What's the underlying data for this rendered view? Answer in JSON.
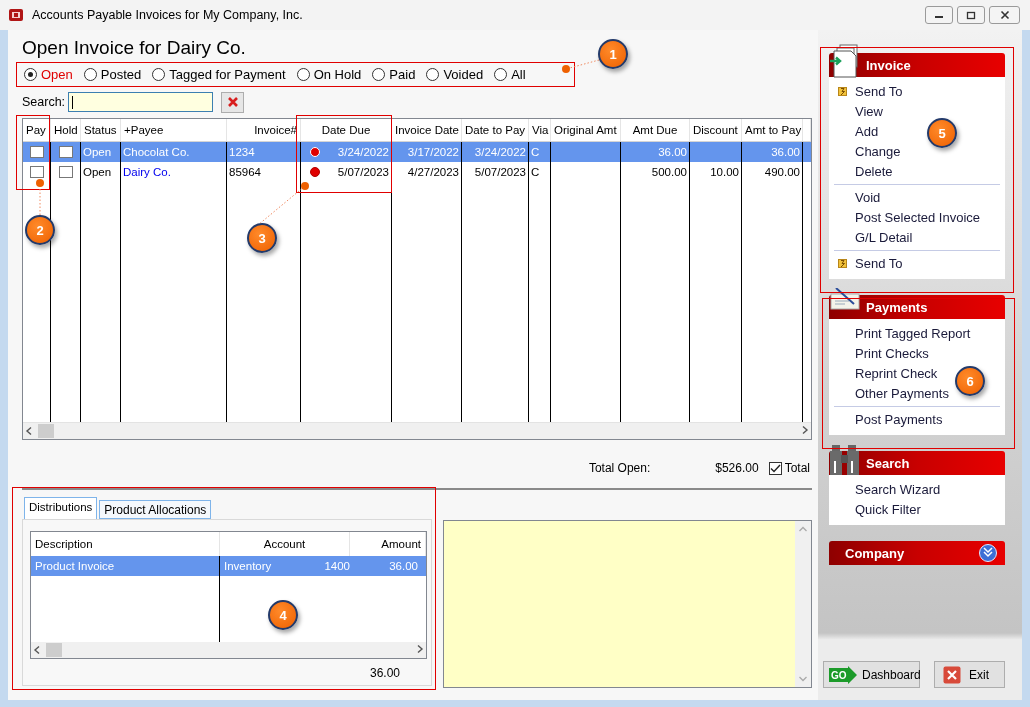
{
  "window": {
    "title": "Accounts Payable Invoices for My Company, Inc."
  },
  "heading": "Open Invoice for Dairy Co.",
  "filters": [
    {
      "label": "Open",
      "selected": true
    },
    {
      "label": "Posted",
      "selected": false
    },
    {
      "label": "Tagged for Payment",
      "selected": false
    },
    {
      "label": "On Hold",
      "selected": false
    },
    {
      "label": "Paid",
      "selected": false
    },
    {
      "label": "Voided",
      "selected": false
    },
    {
      "label": "All",
      "selected": false
    }
  ],
  "search": {
    "label": "Search:"
  },
  "invoices": {
    "columns": [
      "Pay",
      "Hold",
      "Status",
      "+Payee",
      "Invoice#",
      "Date Due",
      "Invoice Date",
      "Date to Pay",
      "Via",
      "Original Amt",
      "Amt Due",
      "Discount",
      "Amt to Pay"
    ],
    "rows": [
      {
        "selected": true,
        "pay": false,
        "hold": false,
        "status": "Open",
        "payee": "Chocolat Co.",
        "invoice_no": "1234",
        "date_due": "3/24/2022",
        "invoice_date": "3/17/2022",
        "date_to_pay": "3/24/2022",
        "via": "C",
        "amt_due": "36.00",
        "amt_to_pay": "36.00"
      },
      {
        "selected": false,
        "pay": false,
        "hold": false,
        "status": "Open",
        "payee": "Dairy Co.",
        "invoice_no": "85964",
        "date_due": "5/07/2023",
        "invoice_date": "4/27/2023",
        "date_to_pay": "5/07/2023",
        "via": "C",
        "amt_due": "500.00",
        "discount": "10.00",
        "amt_to_pay": "490.00"
      }
    ]
  },
  "totals": {
    "label": "Total Open:",
    "value": "$526.00",
    "checkbox": {
      "label": "Total",
      "checked": true
    }
  },
  "detail_tabs": [
    {
      "label": "Distributions",
      "selected": true
    },
    {
      "label": "Product Allocations",
      "selected": false
    }
  ],
  "distributions": {
    "columns": [
      "Description",
      "Account",
      "Amount"
    ],
    "rows": [
      {
        "selected": true,
        "description": "Product Invoice",
        "account": "Inventory",
        "account_no": "1400",
        "amount": "36.00"
      }
    ],
    "total": "36.00"
  },
  "task_panels": [
    {
      "title": "Invoice",
      "kind": "invoice",
      "expanded": true,
      "groups": [
        [
          {
            "label": "Send To",
            "kind": "send-to"
          },
          {
            "label": "View",
            "kind": "action"
          },
          {
            "label": "Add",
            "kind": "action"
          },
          {
            "label": "Change",
            "kind": "action"
          },
          {
            "label": "Delete",
            "kind": "action"
          }
        ],
        [
          {
            "label": "Void",
            "kind": "action"
          },
          {
            "label": "Post Selected Invoice",
            "kind": "action"
          },
          {
            "label": "G/L Detail",
            "kind": "action"
          }
        ],
        [
          {
            "label": "Send To",
            "kind": "send-to"
          }
        ]
      ]
    },
    {
      "title": "Payments",
      "kind": "payments",
      "expanded": true,
      "groups": [
        [
          {
            "label": "Print Tagged Report",
            "kind": "action"
          },
          {
            "label": "Print Checks",
            "kind": "action"
          },
          {
            "label": "Reprint Check",
            "kind": "action"
          },
          {
            "label": "Other Payments",
            "kind": "action"
          }
        ],
        [
          {
            "label": "Post Payments",
            "kind": "action"
          }
        ]
      ]
    },
    {
      "title": "Search",
      "kind": "search",
      "expanded": true,
      "groups": [
        [
          {
            "label": "Search Wizard",
            "kind": "action"
          },
          {
            "label": "Quick Filter",
            "kind": "action"
          }
        ]
      ]
    },
    {
      "title": "Company",
      "kind": "company",
      "expanded": false
    }
  ],
  "buttons": [
    {
      "label": "Dashboard",
      "kind": "dashboard",
      "icon_text": "GO"
    },
    {
      "label": "Exit",
      "kind": "exit"
    }
  ],
  "callouts": [
    {
      "label": "1"
    },
    {
      "label": "2"
    },
    {
      "label": "3"
    },
    {
      "label": "4"
    },
    {
      "label": "5"
    },
    {
      "label": "6"
    }
  ]
}
